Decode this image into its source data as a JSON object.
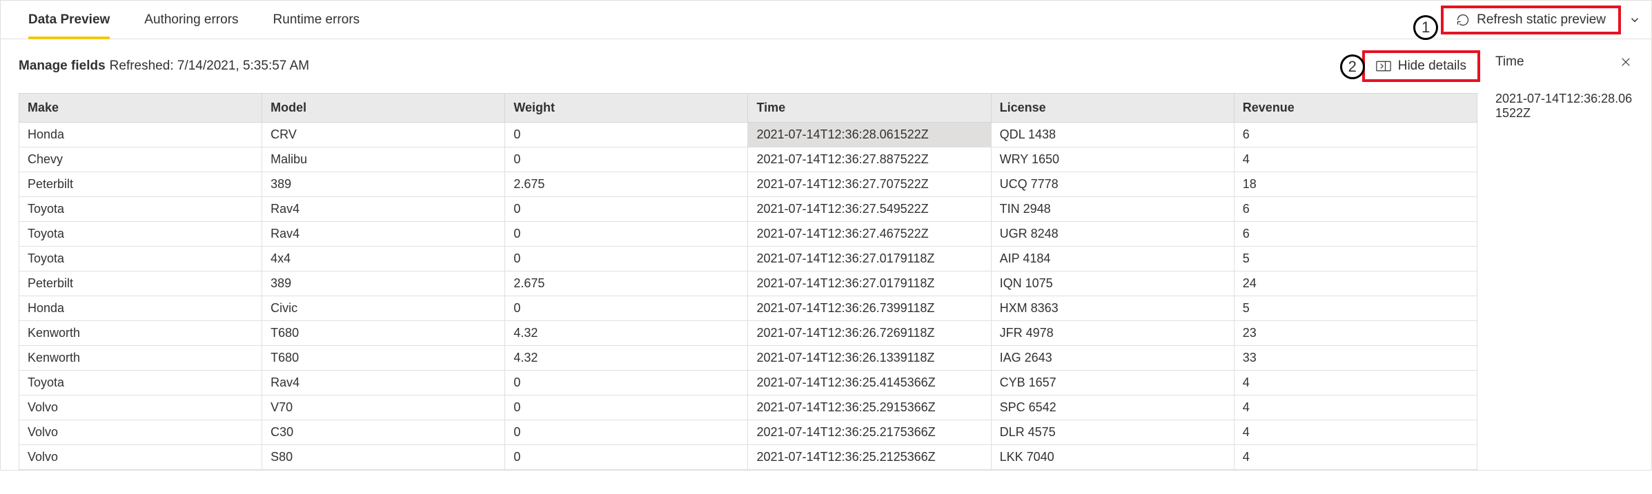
{
  "tabs": {
    "data_preview": "Data Preview",
    "authoring_errors": "Authoring errors",
    "runtime_errors": "Runtime errors"
  },
  "toolbar": {
    "refresh_label": "Refresh static preview"
  },
  "header": {
    "title": "Manage fields",
    "refreshed": "Refreshed: 7/14/2021, 5:35:57 AM",
    "hide_details_label": "Hide details"
  },
  "details": {
    "title": "Time",
    "value": "2021-07-14T12:36:28.061522Z"
  },
  "callouts": {
    "n1": "1",
    "n2": "2"
  },
  "table": {
    "columns": [
      "Make",
      "Model",
      "Weight",
      "Time",
      "License",
      "Revenue"
    ],
    "selected_row_index": 0,
    "selected_col_index": 3,
    "rows": [
      {
        "make": "Honda",
        "model": "CRV",
        "weight": "0",
        "time": "2021-07-14T12:36:28.061522Z",
        "license": "QDL 1438",
        "revenue": "6"
      },
      {
        "make": "Chevy",
        "model": "Malibu",
        "weight": "0",
        "time": "2021-07-14T12:36:27.887522Z",
        "license": "WRY 1650",
        "revenue": "4"
      },
      {
        "make": "Peterbilt",
        "model": "389",
        "weight": "2.675",
        "time": "2021-07-14T12:36:27.707522Z",
        "license": "UCQ 7778",
        "revenue": "18"
      },
      {
        "make": "Toyota",
        "model": "Rav4",
        "weight": "0",
        "time": "2021-07-14T12:36:27.549522Z",
        "license": "TIN 2948",
        "revenue": "6"
      },
      {
        "make": "Toyota",
        "model": "Rav4",
        "weight": "0",
        "time": "2021-07-14T12:36:27.467522Z",
        "license": "UGR 8248",
        "revenue": "6"
      },
      {
        "make": "Toyota",
        "model": "4x4",
        "weight": "0",
        "time": "2021-07-14T12:36:27.0179118Z",
        "license": "AIP 4184",
        "revenue": "5"
      },
      {
        "make": "Peterbilt",
        "model": "389",
        "weight": "2.675",
        "time": "2021-07-14T12:36:27.0179118Z",
        "license": "IQN 1075",
        "revenue": "24"
      },
      {
        "make": "Honda",
        "model": "Civic",
        "weight": "0",
        "time": "2021-07-14T12:36:26.7399118Z",
        "license": "HXM 8363",
        "revenue": "5"
      },
      {
        "make": "Kenworth",
        "model": "T680",
        "weight": "4.32",
        "time": "2021-07-14T12:36:26.7269118Z",
        "license": "JFR 4978",
        "revenue": "23"
      },
      {
        "make": "Kenworth",
        "model": "T680",
        "weight": "4.32",
        "time": "2021-07-14T12:36:26.1339118Z",
        "license": "IAG 2643",
        "revenue": "33"
      },
      {
        "make": "Toyota",
        "model": "Rav4",
        "weight": "0",
        "time": "2021-07-14T12:36:25.4145366Z",
        "license": "CYB 1657",
        "revenue": "4"
      },
      {
        "make": "Volvo",
        "model": "V70",
        "weight": "0",
        "time": "2021-07-14T12:36:25.2915366Z",
        "license": "SPC 6542",
        "revenue": "4"
      },
      {
        "make": "Volvo",
        "model": "C30",
        "weight": "0",
        "time": "2021-07-14T12:36:25.2175366Z",
        "license": "DLR 4575",
        "revenue": "4"
      },
      {
        "make": "Volvo",
        "model": "S80",
        "weight": "0",
        "time": "2021-07-14T12:36:25.2125366Z",
        "license": "LKK 7040",
        "revenue": "4"
      }
    ]
  }
}
